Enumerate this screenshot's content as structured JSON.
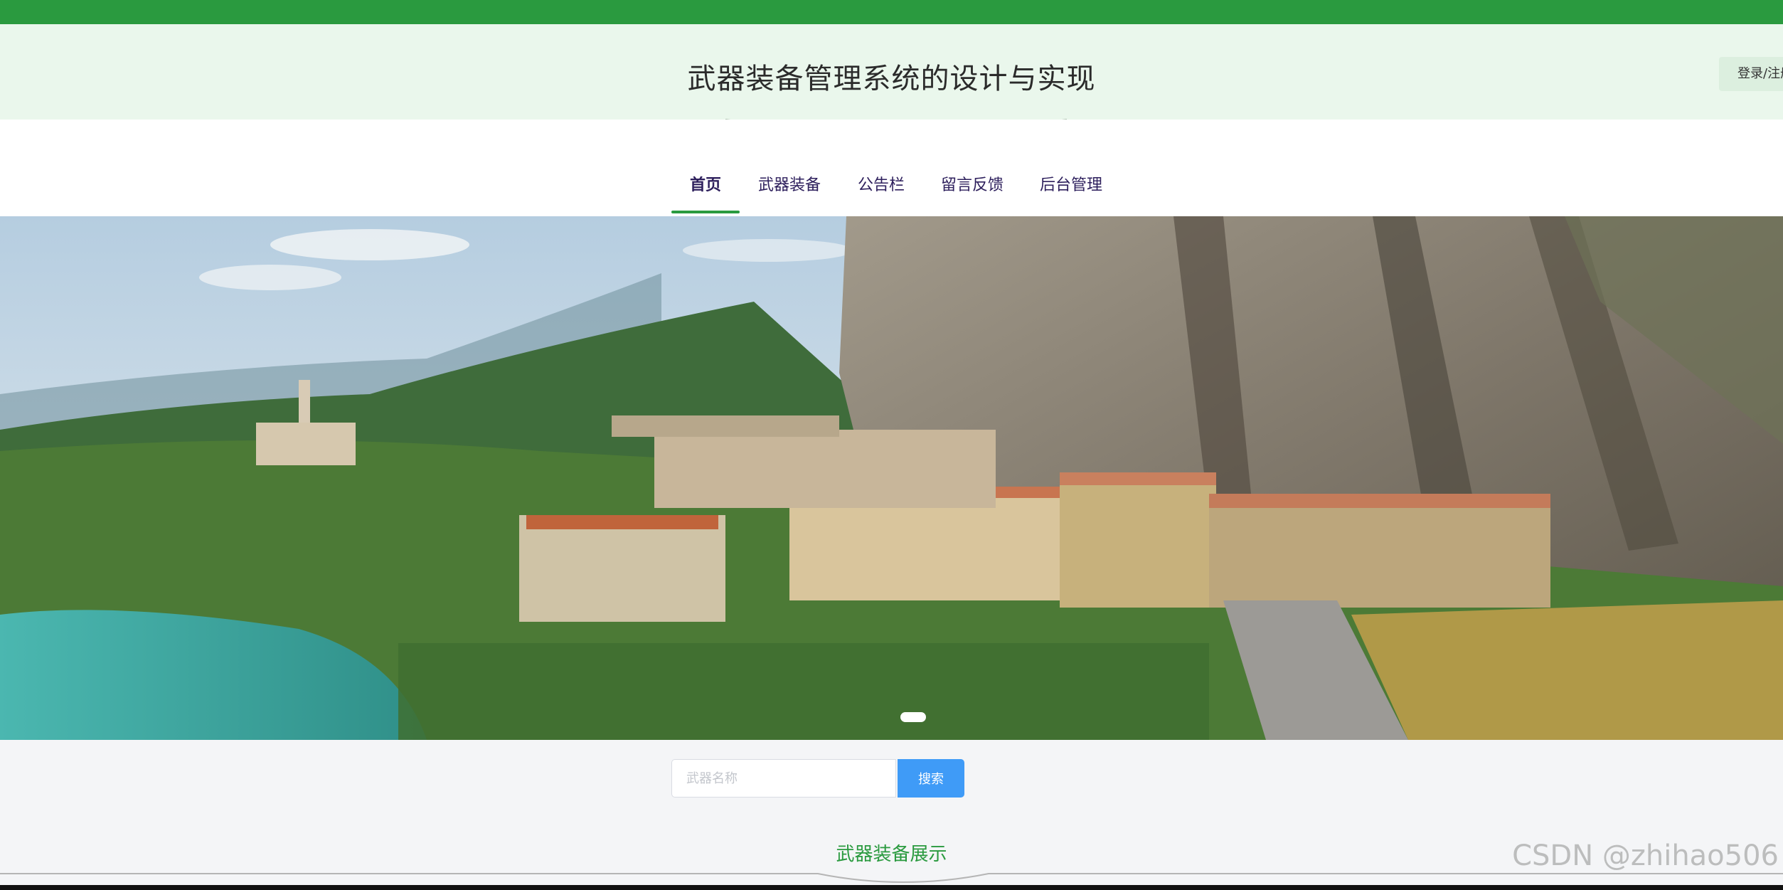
{
  "header": {
    "site_title": "武器装备管理系统的设计与实现",
    "login_label": "登录/注册"
  },
  "nav": {
    "items": [
      "首页",
      "武器装备",
      "公告栏",
      "留言反馈",
      "后台管理"
    ]
  },
  "search": {
    "placeholder": "武器名称",
    "button_label": "搜索"
  },
  "section": {
    "title": "武器装备展示"
  },
  "watermark": "CSDN @zhihao506",
  "colors": {
    "brand_green": "#2a9a3f",
    "header_bg": "#eaf7ec",
    "search_button": "#3f9bf7",
    "nav_text": "#2d1f5c"
  }
}
